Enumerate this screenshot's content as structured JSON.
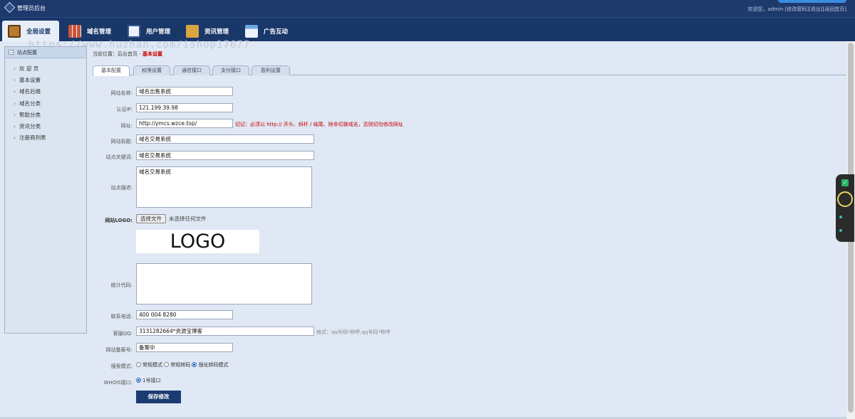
{
  "topbar": {
    "app_title": "管理员后台",
    "welcome": "欢迎您，admin",
    "change_password": "[修改密码]",
    "logout": "[退出]",
    "home": "[返回首页]"
  },
  "nav": [
    {
      "label": "全局设置",
      "icon": "settings-box-icon"
    },
    {
      "label": "域名管理",
      "icon": "domain-grid-icon"
    },
    {
      "label": "用户管理",
      "icon": "user-card-icon"
    },
    {
      "label": "资讯管理",
      "icon": "news-folder-icon"
    },
    {
      "label": "广告互动",
      "icon": "ad-window-icon"
    }
  ],
  "watermark": "https://www.huzhan.com/ishop17677",
  "sidebar": {
    "title": "站点配置",
    "items": [
      "欢 迎 页",
      "基本设置",
      "域名后缀",
      "域名分类",
      "帮助分类",
      "资讯分类",
      "注册商列表"
    ]
  },
  "breadcrumb": {
    "prefix": "当前位置：后台首页 - ",
    "current": "基本设置"
  },
  "tabs": [
    "基本配置",
    "权限设置",
    "通信接口",
    "支付接口",
    "盈利设置"
  ],
  "form": {
    "site_name_label": "网站名称:",
    "site_name": "域名出售系统",
    "auth_ip_label": "认证IP:",
    "auth_ip": "121.199.39.98",
    "url_label": "网址:",
    "url": "http://ymcs.wzce.top/",
    "url_hint": "切记：必须以 http:// 开头、斜杆 / 结尾、除非切换域名，否则切勿修改网址",
    "site_title_label": "网站标题:",
    "site_title": "域名交易系统",
    "keywords_label": "站点关键词:",
    "keywords": "域名交易系统",
    "description_label": "站点描述:",
    "description": "域名交易系统",
    "logo_label": "网站LOGO:",
    "file_button": "选择文件",
    "file_status": "未选择任何文件",
    "logo_text": "LOGO",
    "stats_label": "统计代码:",
    "stats": "",
    "phone_label": "联系电话:",
    "phone": "400 004 8280",
    "qq_label": "客服QQ:",
    "qq": "3131282664*资源宝博客",
    "qq_hint": "格式：qq号码*称呼,qq号码*称呼",
    "icp_label": "网站备案号:",
    "icp": "备案中",
    "search_mode_label": "搜索模式:",
    "search_modes": [
      "常规模式",
      "常规转码",
      "强化转码模式"
    ],
    "search_mode_selected": "强化转码模式",
    "whois_label": "WHOIS接口:",
    "whois_option": "1号接口",
    "save_button": "保存修改"
  },
  "colors": {
    "topbar": "#1e3a6d",
    "navbar": "#1a376a",
    "warning": "#cc0000",
    "save_button": "#1b3c73"
  }
}
